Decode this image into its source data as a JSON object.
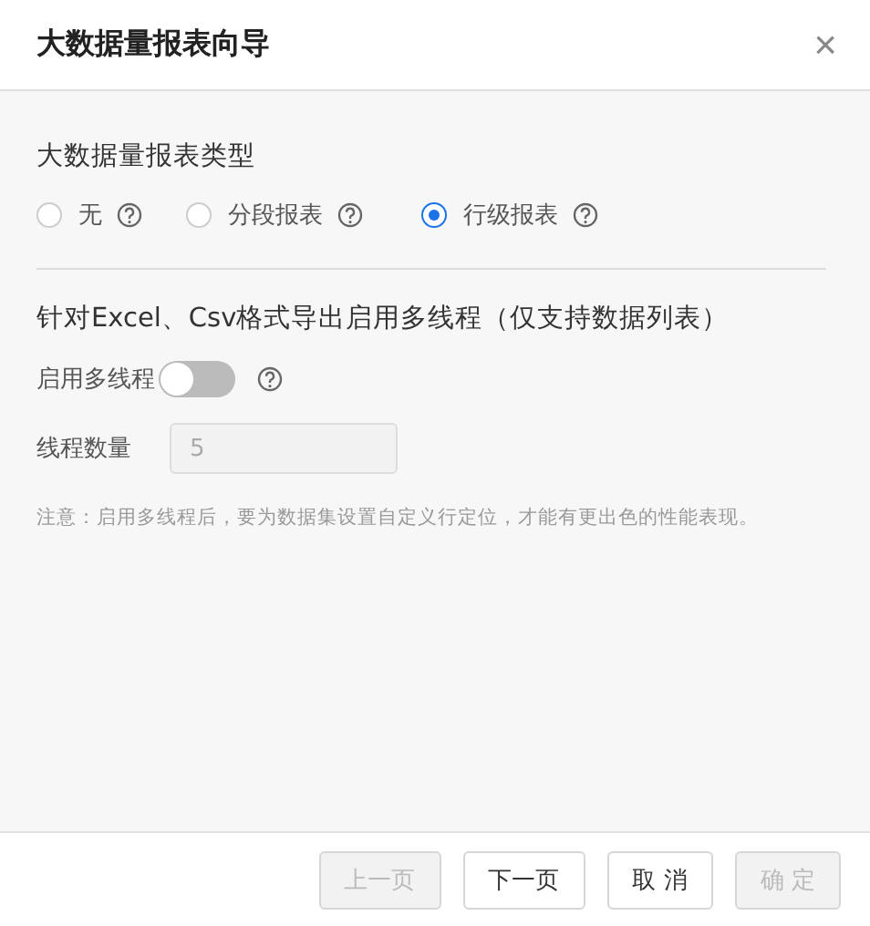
{
  "window": {
    "title": "大数据量报表向导",
    "close": "×"
  },
  "report_type": {
    "heading": "大数据量报表类型",
    "options": [
      {
        "label": "无",
        "selected": false
      },
      {
        "label": "分段报表",
        "selected": false
      },
      {
        "label": "行级报表",
        "selected": true
      }
    ]
  },
  "multithread": {
    "heading": "针对Excel、Csv格式导出启用多线程（仅支持数据列表）",
    "toggle": {
      "label": "启用多线程",
      "on": false
    },
    "thread_count": {
      "label": "线程数量",
      "value": "5",
      "disabled": true
    },
    "note": "注意：启用多线程后，要为数据集设置自定义行定位，才能有更出色的性能表现。"
  },
  "buttons": [
    {
      "label": "上一页",
      "disabled": true
    },
    {
      "label": "下一页",
      "disabled": false
    },
    {
      "label": "取 消",
      "disabled": false
    },
    {
      "label": "确 定",
      "disabled": true
    }
  ]
}
